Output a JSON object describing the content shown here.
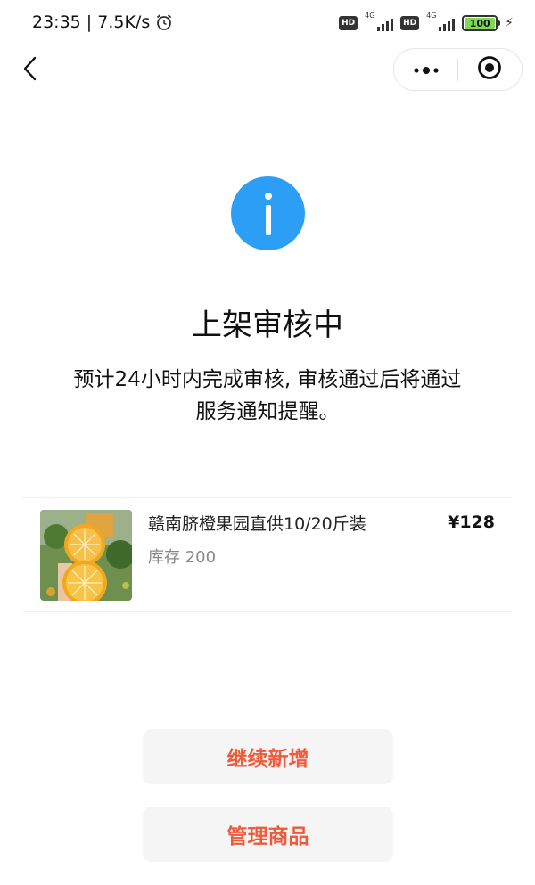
{
  "status_bar": {
    "time_speed": "23:35 | 7.5K/s",
    "hd_label": "HD",
    "network_label": "4G",
    "battery_level": "100",
    "battery_color": "#7ed957"
  },
  "nav": {
    "back_icon": "chevron-left-icon",
    "more_icon": "more-dots-icon",
    "close_icon": "target-circle-icon"
  },
  "status": {
    "icon": "info-icon",
    "icon_color": "#2c9ef5",
    "title": "上架审核中",
    "line1": "预计24小时内完成审核, 审核通过后将通过",
    "line2": "服务通知提醒。"
  },
  "product": {
    "name": "赣南脐橙果园直供10/20斤装",
    "stock": "库存 200",
    "price": "¥128"
  },
  "actions": {
    "continue_label": "继续新增",
    "manage_label": "管理商品",
    "accent_color": "#f05a3a"
  }
}
